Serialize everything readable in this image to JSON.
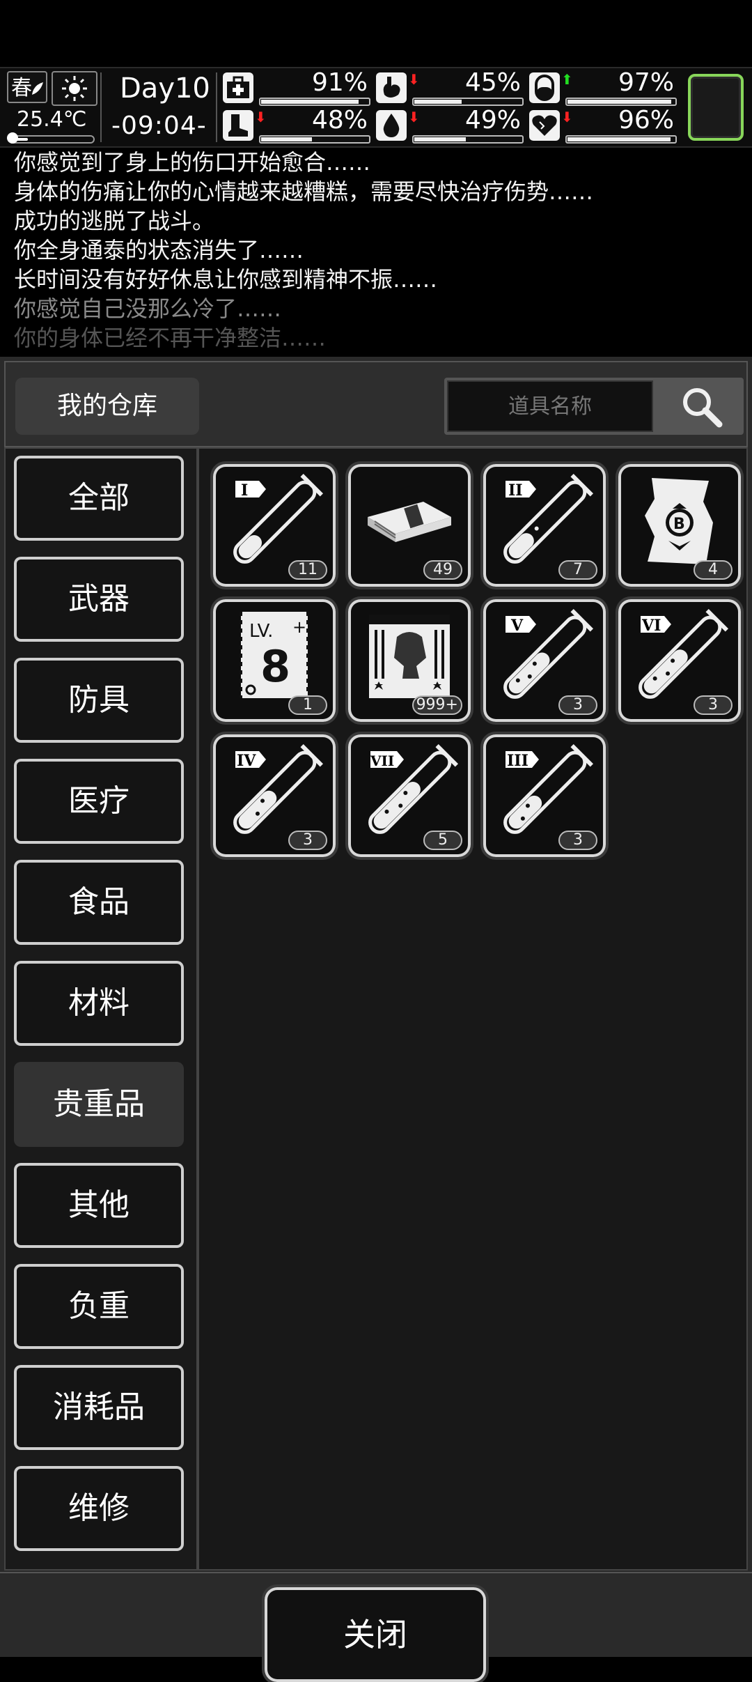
{
  "status": {
    "season": "春",
    "weather_icon": "sun-icon",
    "temperature": "25.4℃",
    "temperature_level": 0.2,
    "day": "Day10",
    "time": "-09:04-",
    "stats": [
      {
        "name": "health",
        "icon": "medkit-icon",
        "arrow": "",
        "value": "91%",
        "level": 0.91
      },
      {
        "name": "hunger",
        "icon": "stomach-icon",
        "arrow": "down",
        "value": "45%",
        "level": 0.45
      },
      {
        "name": "energy",
        "icon": "pill-icon",
        "arrow": "up",
        "value": "97%",
        "level": 0.97
      },
      {
        "name": "stamina",
        "icon": "boot-icon",
        "arrow": "down",
        "value": "48%",
        "level": 0.48
      },
      {
        "name": "thirst",
        "icon": "water-drop-icon",
        "arrow": "down",
        "value": "49%",
        "level": 0.49
      },
      {
        "name": "mood",
        "icon": "heart-icon",
        "arrow": "down",
        "value": "96%",
        "level": 0.96
      }
    ]
  },
  "log": [
    "你感觉到了身上的伤口开始愈合……",
    "身体的伤痛让你的心情越来越糟糕，需要尽快治疗伤势……",
    "成功的逃脱了战斗。",
    "你全身通泰的状态消失了……",
    "长时间没有好好休息让你感到精神不振……",
    "你感觉自己没那么冷了……",
    "你的身体已经不再干净整洁……"
  ],
  "panel": {
    "title": "我的仓库",
    "search_placeholder": "道具名称",
    "categories": [
      "全部",
      "武器",
      "防具",
      "医疗",
      "食品",
      "材料",
      "贵重品",
      "其他",
      "负重",
      "消耗品",
      "维修"
    ],
    "active_category": "贵重品",
    "items": [
      {
        "icon": "test-tube-I-icon",
        "badge": "I",
        "count": "11"
      },
      {
        "icon": "cash-bundle-icon",
        "count": "49"
      },
      {
        "icon": "test-tube-II-icon",
        "badge": "II",
        "count": "7"
      },
      {
        "icon": "bitcoin-map-icon",
        "count": "4"
      },
      {
        "icon": "level-8-card-icon",
        "card_text": "LV.",
        "card_number": "8",
        "count": "1"
      },
      {
        "icon": "zombie-ticket-icon",
        "count": "999+"
      },
      {
        "icon": "test-tube-V-icon",
        "badge": "V",
        "count": "3"
      },
      {
        "icon": "test-tube-VI-icon",
        "badge": "VI",
        "count": "3"
      },
      {
        "icon": "test-tube-IV-icon",
        "badge": "IV",
        "count": "3"
      },
      {
        "icon": "test-tube-VII-icon",
        "badge": "VII",
        "count": "5"
      },
      {
        "icon": "test-tube-III-icon",
        "badge": "III",
        "count": "3"
      }
    ],
    "close_label": "关闭"
  }
}
